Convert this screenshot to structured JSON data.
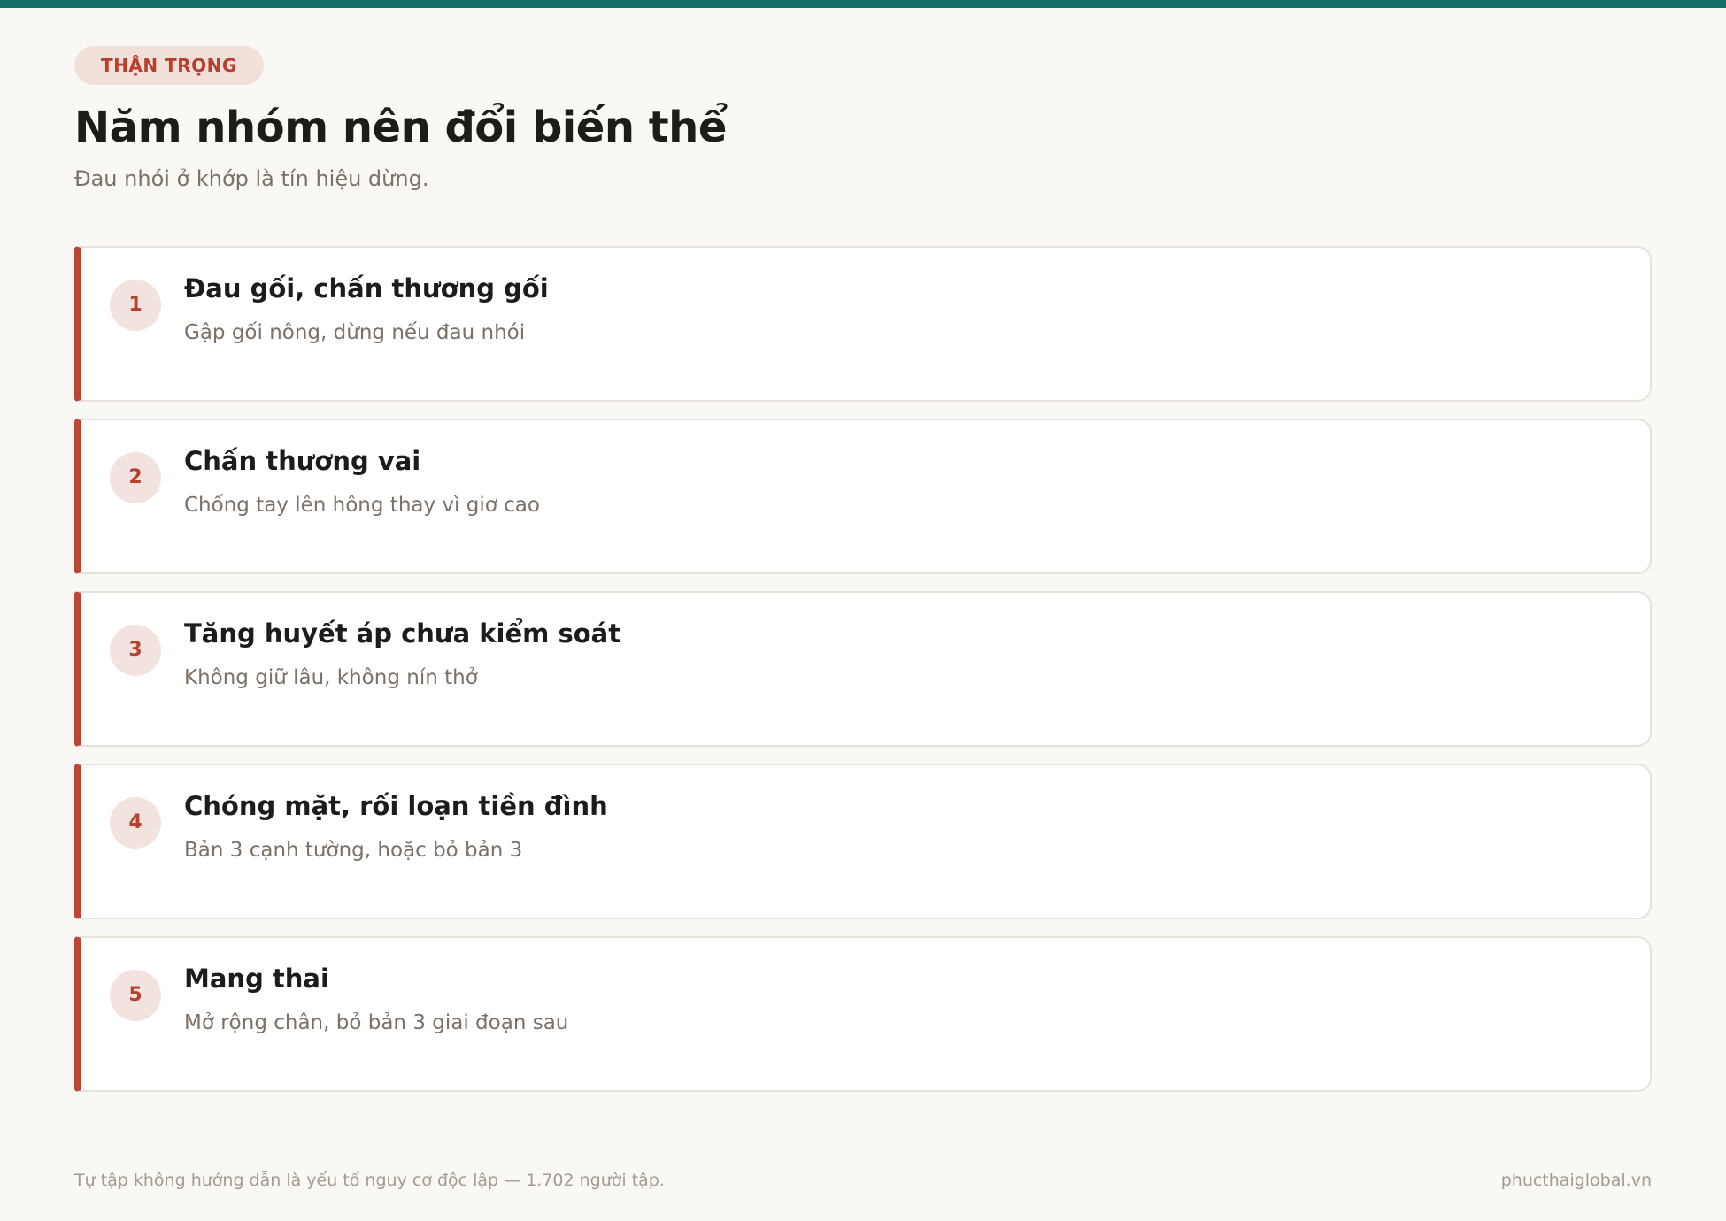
{
  "header": {
    "badge": "THẬN TRỌNG",
    "title": "Năm nhóm nên đổi biến thể",
    "subtitle": "Đau nhói ở khớp là tín hiệu dừng."
  },
  "cards": [
    {
      "number": "1",
      "title": "Đau gối, chấn thương gối",
      "description": "Gập gối nông, dừng nếu đau nhói"
    },
    {
      "number": "2",
      "title": "Chấn thương vai",
      "description": "Chống tay lên hông thay vì giơ cao"
    },
    {
      "number": "3",
      "title": "Tăng huyết áp chưa kiểm soát",
      "description": "Không giữ lâu, không nín thở"
    },
    {
      "number": "4",
      "title": "Chóng mặt, rối loạn tiền đình",
      "description": "Bản 3 cạnh tường, hoặc bỏ bản 3"
    },
    {
      "number": "5",
      "title": "Mang thai",
      "description": "Mở rộng chân, bỏ bản 3 giai đoạn sau"
    }
  ],
  "footer": {
    "note": "Tự tập không hướng dẫn là yếu tố nguy cơ độc lập — 1.702 người tập.",
    "site": "phucthaiglobal.vn"
  },
  "colors": {
    "accent_bar": "#177068",
    "caution": "#bc4535",
    "background": "#faf8f4"
  }
}
